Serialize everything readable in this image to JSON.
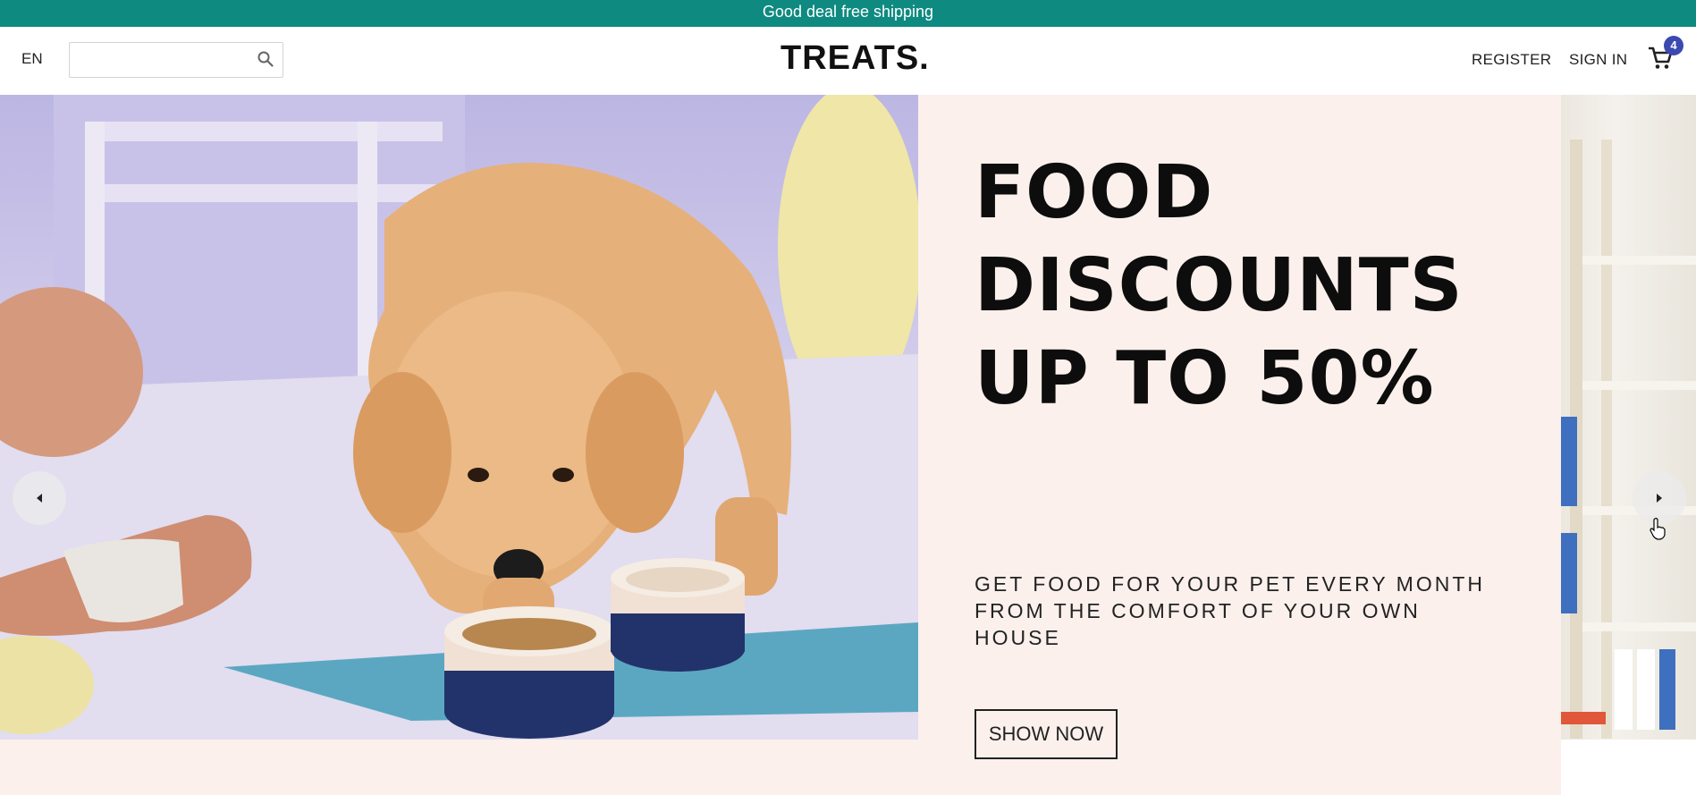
{
  "topbar": {
    "text": "Good deal free shipping",
    "color": "#0f8a80"
  },
  "header": {
    "language": "EN",
    "search": {
      "placeholder": "",
      "value": ""
    },
    "logo": "TREATS.",
    "register_label": "REGISTER",
    "signin_label": "SIGN IN",
    "cart": {
      "icon": "cart-icon",
      "count": "4",
      "badge_color": "#3c49b0"
    }
  },
  "hero": {
    "headline_lines": [
      "FOOD",
      "DISCOUNTS",
      "UP TO 50%"
    ],
    "subline_lines": [
      "GET FOOD FOR YOUR PET EVERY MONTH",
      "FROM THE COMFORT OF YOUR OWN",
      "HOUSE"
    ],
    "cta_label": "SHOW NOW",
    "panel_color": "#fbf0ec",
    "prev_icon": "chevron-left-icon",
    "next_icon": "chevron-right-icon"
  }
}
